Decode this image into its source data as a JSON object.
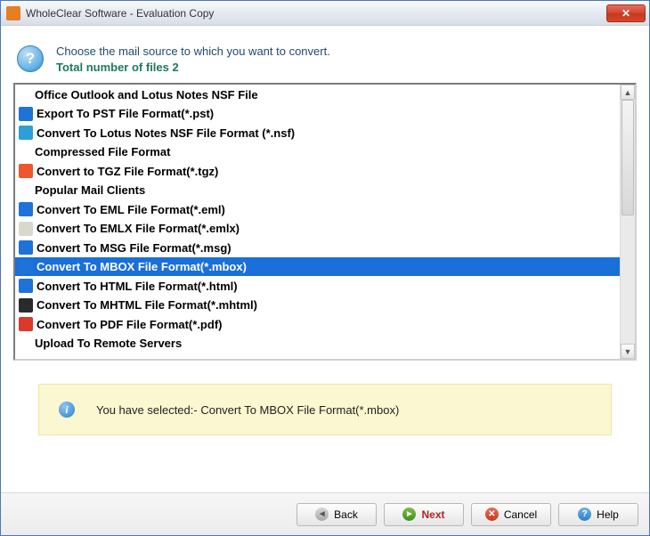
{
  "title": "WholeClear Software - Evaluation Copy",
  "header": {
    "line1": "Choose the mail source to which you want to convert.",
    "line2": "Total number of files 2"
  },
  "list": [
    {
      "type": "header",
      "label": "Office Outlook and Lotus Notes NSF File"
    },
    {
      "type": "item",
      "icon": "#1e73d8",
      "label": "Export To PST File Format(*.pst)"
    },
    {
      "type": "item",
      "icon": "#2d9fd8",
      "label": "Convert To Lotus Notes NSF File Format (*.nsf)"
    },
    {
      "type": "header",
      "label": "Compressed File Format"
    },
    {
      "type": "item",
      "icon": "#f0552c",
      "label": "Convert to TGZ File Format(*.tgz)"
    },
    {
      "type": "header",
      "label": "Popular Mail Clients"
    },
    {
      "type": "item",
      "icon": "#1e73d8",
      "label": "Convert To EML File Format(*.eml)"
    },
    {
      "type": "item",
      "icon": "#d8d8cc",
      "label": "Convert To EMLX File Format(*.emlx)"
    },
    {
      "type": "item",
      "icon": "#1e73d8",
      "label": "Convert To MSG File Format(*.msg)"
    },
    {
      "type": "item",
      "icon": "#1e73d8",
      "label": "Convert To MBOX File Format(*.mbox)",
      "selected": true
    },
    {
      "type": "item",
      "icon": "#1e73d8",
      "label": "Convert To HTML File Format(*.html)"
    },
    {
      "type": "item",
      "icon": "#2a2a2a",
      "label": "Convert To MHTML File Format(*.mhtml)"
    },
    {
      "type": "item",
      "icon": "#d93a2a",
      "label": "Convert To PDF File Format(*.pdf)"
    },
    {
      "type": "header",
      "label": "Upload To Remote Servers"
    }
  ],
  "banner": {
    "text": "You have selected:- Convert To MBOX File Format(*.mbox)"
  },
  "buttons": {
    "back": "Back",
    "next": "Next",
    "cancel": "Cancel",
    "help": "Help"
  }
}
